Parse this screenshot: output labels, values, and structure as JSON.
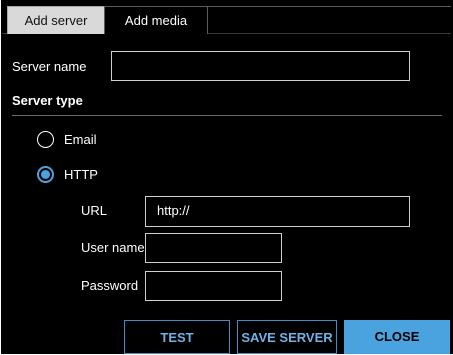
{
  "tabs": [
    {
      "label": "Add server",
      "active": true
    },
    {
      "label": "Add media",
      "active": false
    }
  ],
  "form": {
    "server_name_label": "Server name",
    "server_name_value": "",
    "server_type_label": "Server type",
    "email_label": "Email",
    "email_selected": false,
    "http_label": "HTTP",
    "http_selected": true,
    "url_label": "URL",
    "url_value": "http://",
    "username_label": "User name",
    "username_value": "",
    "password_label": "Password",
    "password_value": ""
  },
  "buttons": {
    "test": "TEST",
    "save_server": "SAVE SERVER",
    "close": "CLOSE"
  },
  "colors": {
    "accent": "#4aa3df",
    "background": "#000000",
    "tab_active": "#d9d9d9"
  }
}
